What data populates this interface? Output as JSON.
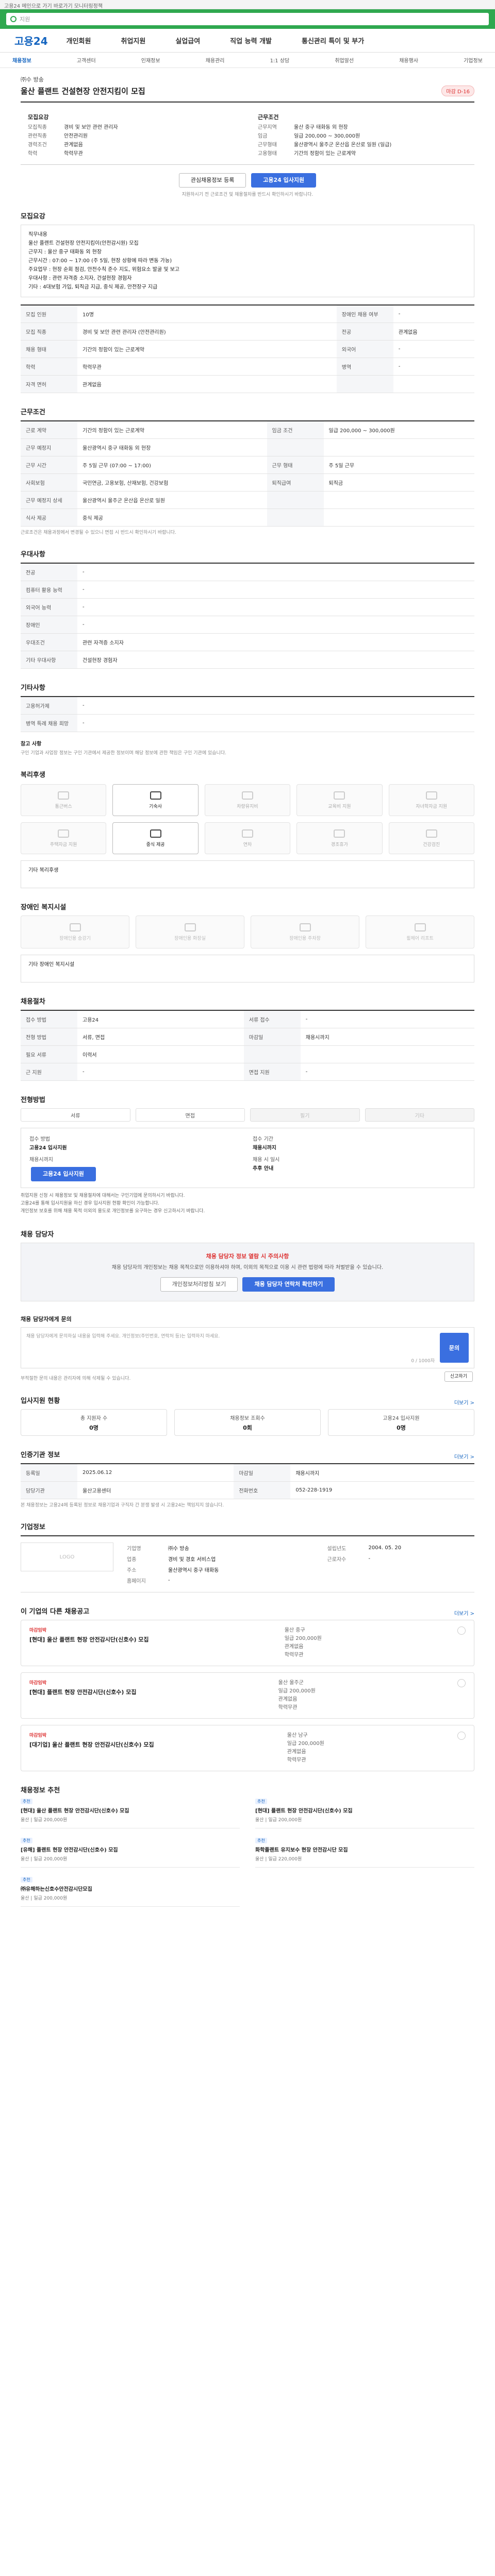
{
  "site": {
    "top_notice": "고용24 메인으로 가기 바로가기 모니터링정책",
    "search_placeholder": "지원",
    "logo": "고용24",
    "menu": [
      "개인회원",
      "취업지원",
      "실업급여",
      "직업 능력 개발",
      "통신관리 특이 및 부가"
    ],
    "breadcrumbs": [
      "채용정보",
      "고객센터",
      "인재정보",
      "채용관리",
      "1:1 상담",
      "취업알선",
      "채용행사",
      "기업정보"
    ]
  },
  "job": {
    "company": "㈜수 방송",
    "title": "울산 플랜트 건설현장 안전지킴이 모집",
    "badge": "마감 D-16",
    "left_heading": "모집요강",
    "right_heading": "근무조건",
    "left_rows": [
      {
        "k": "모집직종",
        "v": "경비 및 보안 관련 관리자"
      },
      {
        "k": "관련직종",
        "v": "안전관리원"
      },
      {
        "k": "경력조건",
        "v": "관계없음"
      },
      {
        "k": "학력",
        "v": "학력무관"
      }
    ],
    "right_rows": [
      {
        "k": "근무지역",
        "v": "울산 중구 태화동 외 현장"
      },
      {
        "k": "임금",
        "v": "일급 200,000 ~ 300,000원"
      },
      {
        "k": "근무형태",
        "v": "울산광역시 울주군 온산읍 온산로 일원 (일급)"
      },
      {
        "k": "고용형태",
        "v": "기간의 정함이 있는 근로계약"
      }
    ],
    "scrap_label": "관심채용정보 등록",
    "apply_label": "고용24 입사지원",
    "note": "지원하시기 전 근로조건 및 채용절차를 반드시 확인하시기 바랍니다."
  },
  "detail": {
    "title": "모집요강",
    "body": [
      "직무내용",
      "울산 플랜트 건설현장 안전지킴이(안전감시원) 모집",
      "근무지 : 울산 중구 태화동 외 현장",
      "근무시간 : 07:00 ~ 17:00 (주 5일, 현장 상황에 따라 변동 가능)",
      "주요업무 : 현장 순회 점검, 안전수칙 준수 지도, 위험요소 발굴 및 보고",
      "우대사항 : 관련 자격증 소지자, 건설현장 경험자",
      "기타 : 4대보험 가입, 퇴직금 지급, 중식 제공, 안전장구 지급"
    ]
  },
  "req_table": [
    {
      "k": "모집 인원",
      "v": "10명",
      "k2": "장애인 채용 여부",
      "v2": "-"
    },
    {
      "k": "모집 직종",
      "v": "경비 및 보안 관련 관리자 (안전관리원)",
      "k2": "전공",
      "v2": "관계없음"
    },
    {
      "k": "채용 형태",
      "v": "기간의 정함이 있는 근로계약",
      "k2": "외국어",
      "v2": "-"
    },
    {
      "k": "학력",
      "v": "학력무관",
      "k2": "병역",
      "v2": "-"
    },
    {
      "k": "자격 면허",
      "v": "관계없음",
      "k2": "",
      "v2": ""
    }
  ],
  "cond": {
    "title": "근무조건",
    "rows": [
      {
        "k": "근로 계약",
        "v": "기간의 정함이 있는 근로계약",
        "k2": "임금 조건",
        "v2": "일급 200,000 ~ 300,000원"
      },
      {
        "k": "근무 예정지",
        "v": "울산광역시 중구 태화동 외 현장",
        "k2": "",
        "v2": ""
      },
      {
        "k": "근무 시간",
        "v": "주 5일 근무 (07:00 ~ 17:00)",
        "k2": "근무 형태",
        "v2": "주 5일 근무"
      },
      {
        "k": "사회보험",
        "v": "국민연금, 고용보험, 산재보험, 건강보험",
        "k2": "퇴직급여",
        "v2": "퇴직금"
      },
      {
        "k": "근무 예정지 상세",
        "v": "울산광역시 울주군 온산읍 온산로 일원",
        "k2": "",
        "v2": ""
      },
      {
        "k": "식사 제공",
        "v": "중식 제공",
        "k2": "",
        "v2": ""
      }
    ],
    "map_label": "지도보기",
    "footnote": "근로조건은 채용과정에서 변경될 수 있으니 면접 시 반드시 확인하시기 바랍니다."
  },
  "prefer": {
    "title": "우대사항",
    "rows": [
      {
        "k": "전공",
        "v": "-"
      },
      {
        "k": "컴퓨터 활용 능력",
        "v": "-"
      },
      {
        "k": "외국어 능력",
        "v": "-"
      },
      {
        "k": "장애인",
        "v": "-"
      },
      {
        "k": "우대조건",
        "v": "관련 자격증 소지자"
      },
      {
        "k": "기타 우대사항",
        "v": "건설현장 경험자"
      }
    ]
  },
  "etc": {
    "title": "기타사항",
    "rows": [
      {
        "k": "고용허가제",
        "v": "-"
      },
      {
        "k": "병역 특례 채용 희망",
        "v": "-"
      }
    ],
    "reference_title": "참고 사항",
    "reference_text": "구인 기업과 사업장 정보는 구인 기관에서 제공한 정보이며 해당 정보에 관한 책임은 구인 기관에 있습니다."
  },
  "welfare": {
    "title": "복리후생",
    "items": [
      {
        "label": "통근버스",
        "on": false
      },
      {
        "label": "기숙사",
        "on": true
      },
      {
        "label": "차량유지비",
        "on": false
      },
      {
        "label": "교육비 지원",
        "on": false
      },
      {
        "label": "자녀학자금 지원",
        "on": false
      },
      {
        "label": "주택자금 지원",
        "on": false
      },
      {
        "label": "중식 제공",
        "on": true
      },
      {
        "label": "연차",
        "on": false
      },
      {
        "label": "경조휴가",
        "on": false
      },
      {
        "label": "건강검진",
        "on": false
      }
    ],
    "other_label": "기타 복리후생"
  },
  "disabled": {
    "title": "장애인 복지시설",
    "items": [
      "장애인용 승강기",
      "장애인용 화장실",
      "장애인용 주차장",
      "휠체어 리프트"
    ],
    "other_label": "기타 장애인 복지시설"
  },
  "process": {
    "title": "채용절차",
    "rows": [
      {
        "k": "접수 방법",
        "v": "고용24",
        "k2": "서류 접수",
        "v2": "-"
      },
      {
        "k": "전형 방법",
        "v": "서류, 면접",
        "k2": "마감일",
        "v2": "채용시까지"
      },
      {
        "k": "필요 서류",
        "v": "이력서",
        "k2": "",
        "v2": ""
      },
      {
        "k": "근 지원",
        "v": "-",
        "k2": "면접 지원",
        "v2": "-"
      }
    ]
  },
  "apply_method": {
    "title": "전형방법",
    "toggles": [
      "서류",
      "면접",
      "필기",
      "기타"
    ],
    "toggle_on": [
      true,
      true,
      false,
      false
    ],
    "left_label": "접수 방법",
    "left_value": "고용24 입사지원",
    "left_deadline": "채용시까지",
    "right_label": "접수 기간",
    "right_value": "채용시까지",
    "result_label": "채용 시 일시",
    "result_value": "추후 안내",
    "apply_btn": "고용24 입사지원",
    "notices": [
      "취업지원 신청 시 채용정보 및 채용절차에 대해서는 구인기업에 문의하시기 바랍니다.",
      "고용24를 통해 입사지원을 하신 경우 입사지원 현황 확인이 가능합니다.",
      "개인정보 보호를 위해 채용 목적 이외의 용도로 개인정보를 요구하는 경우 신고하시기 바랍니다."
    ]
  },
  "contact": {
    "title": "채용 담당자",
    "warn_head": "채용 담당자 정보 열람 시 주의사항",
    "warn_body": "채용 담당자의 개인정보는 채용 목적으로만 이용하셔야 하며, 이외의 목적으로 이용 시 관련 법령에 따라 처벌받을 수 있습니다.",
    "btn_view": "개인정보처리방침 보기",
    "btn_show": "채용 담당자 연락처 확인하기"
  },
  "qna": {
    "title": "채용 담당자에게 문의",
    "placeholder": "채용 담당자에게 문의하실 내용을 입력해 주세요. 개인정보(주민번호, 연락처 등)는 입력하지 마세요.",
    "count": "0 / 1000자",
    "send": "문의",
    "notes": "부적절한 문의 내용은 관리자에 의해 삭제될 수 있습니다.",
    "report": "신고하기"
  },
  "stats": {
    "title": "입사지원 현황",
    "more": "더보기 >",
    "cards": [
      {
        "label": "총 지원자 수",
        "value": "0명"
      },
      {
        "label": "채용정보 조회수",
        "value": "0회"
      },
      {
        "label": "고용24 입사지원",
        "value": "0명"
      }
    ]
  },
  "org": {
    "title": "인증기관 정보",
    "more": "더보기 >",
    "rows": [
      {
        "k": "등록일",
        "v": "2025.06.12",
        "k2": "마감일",
        "v2": "채용시까지"
      },
      {
        "k": "담당기관",
        "v": "울산고용센터",
        "k2": "전화번호",
        "v2": "052-228-1919"
      }
    ],
    "fine": "본 채용정보는 고용24에 등록된 정보로 채용기업과 구직자 간 분쟁 발생 시 고용24는 책임지지 않습니다."
  },
  "company": {
    "title": "기업정보",
    "logo_text": "LOGO",
    "rows": [
      {
        "k": "기업명",
        "v": "㈜수 방송",
        "k2": "설립년도",
        "v2": "2004. 05. 20"
      },
      {
        "k": "업종",
        "v": "경비 및 경호 서비스업",
        "k2": "근로자수",
        "v2": "-"
      },
      {
        "k": "주소",
        "v": "울산광역시 중구 태화동",
        "k2": "",
        "v2": ""
      },
      {
        "k": "홈페이지",
        "v": "-",
        "k2": "",
        "v2": ""
      }
    ]
  },
  "other_jobs": {
    "title": "이 기업의 다른 채용공고",
    "more": "더보기 >",
    "items": [
      {
        "flag": "마감임박",
        "title": "[현대] 울산 플랜트 현장 안전감시단(신호수) 모집",
        "meta1": "울산 중구",
        "meta2": "일급 200,000원",
        "meta3": "관계없음",
        "meta4": "학력무관"
      },
      {
        "flag": "마감임박",
        "title": "[현대] 플랜트 현장 안전감시단(신호수) 모집",
        "meta1": "울산 울주군",
        "meta2": "일급 200,000원",
        "meta3": "관계없음",
        "meta4": "학력무관"
      },
      {
        "flag": "마감임박",
        "title": "[대기업] 울산 플랜트 현장 안전감시단(신호수) 모집",
        "meta1": "울산 남구",
        "meta2": "일급 200,000원",
        "meta3": "관계없음",
        "meta4": "학력무관"
      }
    ]
  },
  "recommend": {
    "title": "채용정보 추천",
    "items": [
      {
        "tag": "추천",
        "title": "[현대] 울산 플랜트 현장 안전감시단(신호수) 모집",
        "meta": "울산 | 일급 200,000원"
      },
      {
        "tag": "추천",
        "title": "[현대] 플랜트 현장 안전감시단(신호수) 모집",
        "meta": "울산 | 일급 200,000원"
      },
      {
        "tag": "추천",
        "title": "[유해] 플랜트 현장 안전감시단(신호수) 모집",
        "meta": "울산 | 일급 200,000원"
      },
      {
        "tag": "추천",
        "title": "화학플랜트 유지보수 현장 안전감시단 모집",
        "meta": "울산 | 일급 220,000원"
      },
      {
        "tag": "추천",
        "title": "㈜유해하는신호수안전감시단모집",
        "meta": "울산 | 일급 200,000원"
      }
    ]
  }
}
